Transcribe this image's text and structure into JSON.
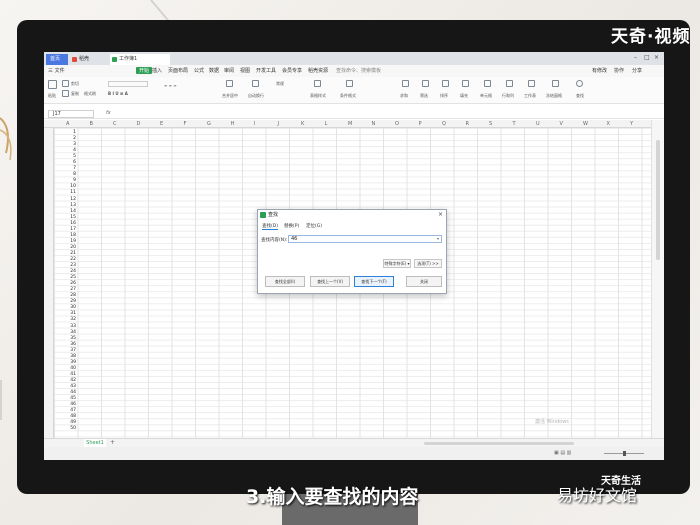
{
  "brand": {
    "top": "天奇·视频",
    "mid": "天奇生活",
    "bottom": "易坊好文馆"
  },
  "caption": "3.输入要查找的内容",
  "colors": {
    "accent_green": "#2e9e55",
    "tab_blue": "#4b77e0",
    "dialog_border": "#2e7fd6"
  },
  "titlebar": {
    "tabs": [
      {
        "label": "首页",
        "icon": "home-icon"
      },
      {
        "label": "稻壳",
        "icon": "docer-icon"
      },
      {
        "label": "工作簿1",
        "icon": "spreadsheet-icon"
      }
    ],
    "controls": [
      "minimize-icon",
      "maximize-icon",
      "close-icon"
    ]
  },
  "menubar": {
    "items": [
      "三 文件",
      "开始",
      "插入",
      "页面布局",
      "公式",
      "数据",
      "审阅",
      "视图",
      "开发工具",
      "会员专享",
      "稻壳资源",
      "查找命令、搜索模板"
    ],
    "right_items": [
      "有修改",
      "协作",
      "分享"
    ]
  },
  "ribbon": {
    "buttons": [
      "粘贴",
      "剪切",
      "复制",
      "格式刷",
      "合并居中",
      "自动换行",
      "常规",
      "表格样式",
      "条件格式",
      "求和",
      "筛选",
      "排序",
      "填充",
      "单元格",
      "行和列",
      "工作表",
      "冻结窗格",
      "查找"
    ]
  },
  "formula_bar": {
    "name_box": "J17",
    "fx": "fx"
  },
  "columns": [
    "A",
    "B",
    "C",
    "D",
    "E",
    "F",
    "G",
    "H",
    "I",
    "J",
    "K",
    "L",
    "M",
    "N",
    "O",
    "P",
    "Q",
    "R",
    "S",
    "T",
    "U",
    "V",
    "W",
    "X",
    "Y"
  ],
  "colA_values": [
    "1",
    "2",
    "3",
    "4",
    "5",
    "6",
    "7",
    "8",
    "9",
    "10",
    "11",
    "12",
    "13",
    "14",
    "15",
    "16",
    "17",
    "18",
    "19",
    "20",
    "21",
    "22",
    "23",
    "24",
    "25",
    "26",
    "27",
    "28",
    "29",
    "30",
    "31",
    "32",
    "33",
    "34",
    "35",
    "36",
    "37",
    "38",
    "39",
    "40",
    "41",
    "42",
    "43",
    "44",
    "45",
    "46",
    "47",
    "48",
    "49",
    "50"
  ],
  "sheet": {
    "tab": "Sheet1"
  },
  "dialog": {
    "title": "查找",
    "tabs": [
      "查找(D)",
      "替换(P)",
      "定位(G)"
    ],
    "find_label": "查找内容(N):",
    "find_value": "46",
    "special_button": "特殊字符(E) ▾",
    "options_button": "选项(T) >>",
    "buttons": [
      "查找全部(I)",
      "查找上一个(V)",
      "查找下一个(F)",
      "关闭"
    ]
  },
  "windows_watermark": "激活 Windows"
}
